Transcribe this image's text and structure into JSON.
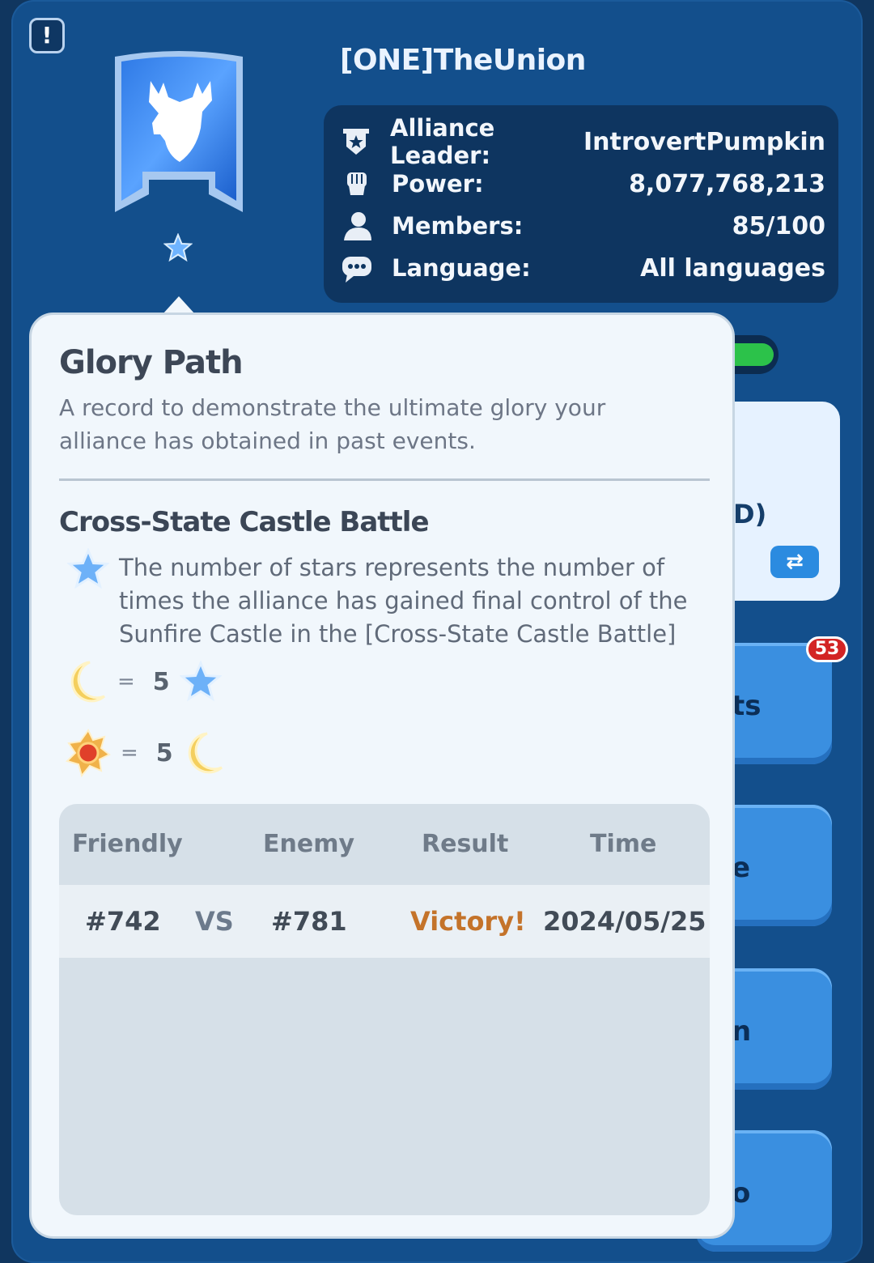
{
  "colors": {
    "panel": "#134f8c",
    "victory": "#c4732a",
    "badge": "#d32424"
  },
  "header": {
    "alert_icon": "exclamation-icon",
    "alliance_name": "[ONE]TheUnion",
    "banner_icon": "moose-emblem-icon"
  },
  "info": {
    "leader": {
      "icon": "shield-star-icon",
      "label": "Alliance Leader:",
      "value": "IntrovertPumpkin"
    },
    "power": {
      "icon": "fist-icon",
      "label": "Power:",
      "value": "8,077,768,213"
    },
    "members": {
      "icon": "person-icon",
      "label": "Members:",
      "value": "85/100"
    },
    "language": {
      "icon": "chat-bubble-icon",
      "label": "Language:",
      "value": "All languages"
    }
  },
  "background": {
    "card_text": "D)",
    "swap_icon": "⇄",
    "notification_count": "53",
    "button_1_text": "ts",
    "button_2_text": "e",
    "button_3_text": "n",
    "button_4_text": "o"
  },
  "popup": {
    "title": "Glory Path",
    "description": "A record to demonstrate the ultimate glory your alliance has obtained in past events.",
    "section_title": "Cross-State Castle Battle",
    "star_note": "The number of stars represents the number of times the alliance has gained final control of the Sunfire Castle in the [Cross-State Castle Battle]",
    "conversions": [
      {
        "from_icon": "moon-icon",
        "eq": "=",
        "count": "5",
        "to_icon": "star-icon"
      },
      {
        "from_icon": "sun-medal-icon",
        "eq": "=",
        "count": "5",
        "to_icon": "moon-icon"
      }
    ],
    "table": {
      "headers": [
        "Friendly",
        "Enemy",
        "Result",
        "Time"
      ],
      "rows": [
        {
          "friendly": "#742",
          "vs": "VS",
          "enemy": "#781",
          "result": "Victory!",
          "time": "2024/05/25"
        }
      ]
    }
  }
}
